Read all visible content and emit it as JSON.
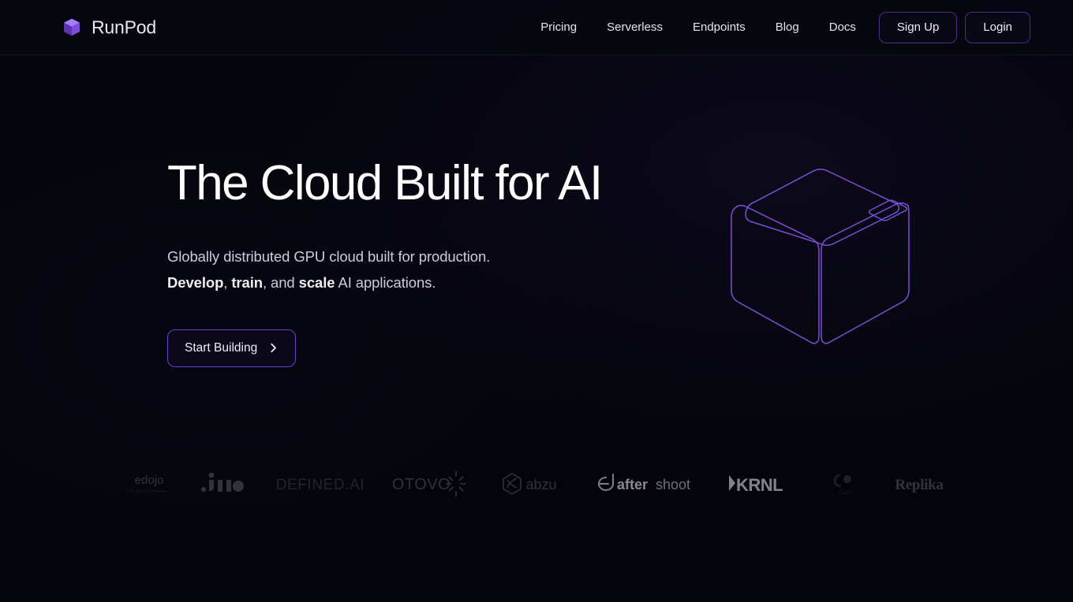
{
  "brand": {
    "name": "RunPod",
    "logo_icon": "cube-icon",
    "accent": "#8b5cf6"
  },
  "header": {
    "nav_links": [
      {
        "label": "Pricing",
        "name": "nav-link-pricing"
      },
      {
        "label": "Serverless",
        "name": "nav-link-serverless"
      },
      {
        "label": "Endpoints",
        "name": "nav-link-endpoints"
      },
      {
        "label": "Blog",
        "name": "nav-link-blog"
      },
      {
        "label": "Docs",
        "name": "nav-link-docs"
      }
    ],
    "signup_label": "Sign Up",
    "login_label": "Login",
    "border_color": "#4b2e86"
  },
  "hero": {
    "title": "The Cloud Built for AI",
    "subtitle_line1": "Globally distributed GPU cloud built for production.",
    "subtitle_line2_parts": {
      "b1": "Develop",
      "sep1": ", ",
      "b2": "train",
      "sep2": ", and ",
      "b3": "scale",
      "tail": " AI applications."
    },
    "cta_label": "Start Building",
    "cta_icon": "chevron-right-icon",
    "art_icon": "wireframe-cube-illustration",
    "art_stroke": "#7c4fd6"
  },
  "logos": {
    "items": [
      {
        "label": "edojo",
        "sub": "ELEARNING",
        "name": "logo-edojo"
      },
      {
        "label": "jina",
        "name": "logo-jina"
      },
      {
        "label": "DEFINED.AI",
        "name": "logo-defined-ai"
      },
      {
        "label": "OTOVO",
        "name": "logo-otovo"
      },
      {
        "label": "abzu",
        "name": "logo-abzu"
      },
      {
        "label": "aftershoot",
        "bold": "after",
        "rest": "shoot",
        "name": "logo-aftershoot"
      },
      {
        "label": "KRNL",
        "name": "logo-krnl"
      },
      {
        "label": "Coqui",
        "name": "logo-coqui"
      },
      {
        "label": "Replika",
        "name": "logo-replika"
      }
    ]
  }
}
